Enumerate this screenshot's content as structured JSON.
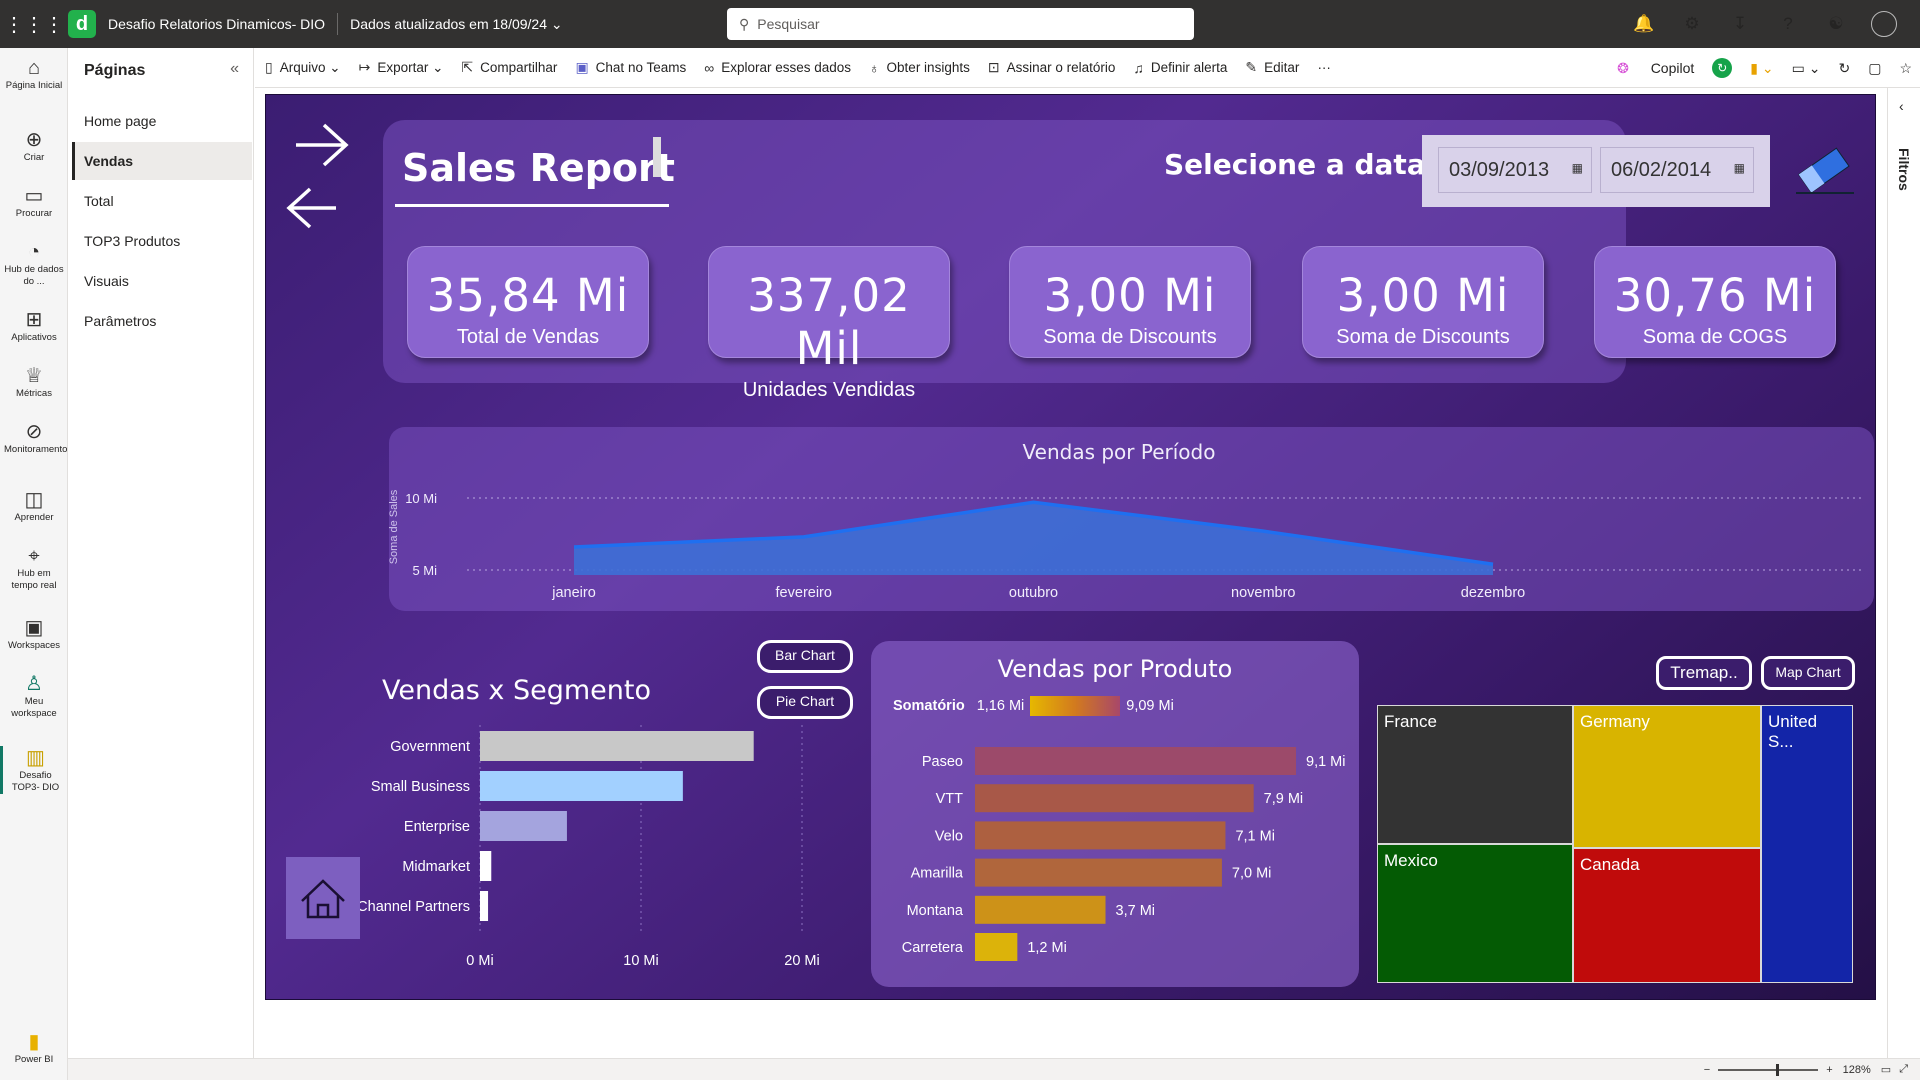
{
  "topbar": {
    "report_name": "Desafio Relatorios Dinamicos- DIO",
    "updated": "Dados atualizados em 18/09/24",
    "search_placeholder": "Pesquisar"
  },
  "leftnav": [
    {
      "label": "Página Inicial",
      "icon": "home-icon"
    },
    {
      "label": "Criar",
      "icon": "plus-icon"
    },
    {
      "label": "Procurar",
      "icon": "folder-icon"
    },
    {
      "label": "Hub de dados do ...",
      "icon": "data-hub-icon"
    },
    {
      "label": "Aplicativos",
      "icon": "apps-icon"
    },
    {
      "label": "Métricas",
      "icon": "trophy-icon"
    },
    {
      "label": "Monitoramento",
      "icon": "monitor-icon"
    },
    {
      "label": "Aprender",
      "icon": "book-icon"
    },
    {
      "label": "Hub em tempo real",
      "icon": "realtime-icon"
    },
    {
      "label": "Workspaces",
      "icon": "workspaces-icon"
    },
    {
      "label": "Meu workspace",
      "icon": "user-icon"
    },
    {
      "label": "Desafio TOP3- DIO",
      "icon": "report-icon"
    },
    {
      "label": "Power BI",
      "icon": "powerbi-icon"
    }
  ],
  "pages": {
    "title": "Páginas",
    "items": [
      "Home page",
      "Vendas",
      "Total",
      "TOP3 Produtos",
      "Visuais",
      "Parâmetros"
    ],
    "active": "Vendas"
  },
  "toolbar": {
    "items": [
      "Arquivo",
      "Exportar",
      "Compartilhar",
      "Chat no Teams",
      "Explorar esses dados",
      "Obter insights",
      "Assinar o relatório",
      "Definir alerta",
      "Editar",
      "···"
    ],
    "copilot": "Copilot"
  },
  "filters": {
    "label": "Filtros"
  },
  "status": {
    "zoom": "128%"
  },
  "report": {
    "title": "Sales Report",
    "date_prompt": "Selecione a data",
    "date_start": "03/09/2013",
    "date_end": "06/02/2014",
    "cards": [
      {
        "value": "35,84 Mi",
        "label": "Total de Vendas"
      },
      {
        "value": "337,02 Mil",
        "label": "Unidades Vendidas"
      },
      {
        "value": "3,00 Mi",
        "label": "Soma de Discounts"
      },
      {
        "value": "3,00 Mi",
        "label": "Soma de Discounts"
      },
      {
        "value": "30,76 Mi",
        "label": "Soma de COGS"
      }
    ],
    "buttons": {
      "bar": "Bar Chart",
      "pie": "Pie Chart",
      "treemap": "Tremap..",
      "map": "Map Chart"
    }
  },
  "colors": {
    "line": "#1f6ff0",
    "area": "#3d6fd6",
    "treemap_france": "#333333",
    "treemap_germany": "#d8b400",
    "treemap_us": "#1325a8",
    "treemap_mexico": "#045b04",
    "treemap_canada": "#c00b0b"
  },
  "chart_data": [
    {
      "type": "area",
      "title": "Vendas por Período",
      "ylabel": "Soma de Sales",
      "categories": [
        "janeiro",
        "fevereiro",
        "outubro",
        "novembro",
        "dezembro"
      ],
      "values": [
        6.6,
        7.3,
        9.7,
        7.7,
        5.4
      ],
      "yticks": [
        "10 Mi",
        "5 Mi"
      ],
      "ylim": [
        0,
        10
      ]
    },
    {
      "type": "bar",
      "title": "Vendas x Segmento",
      "categories": [
        "Government",
        "Small Business",
        "Enterprise",
        "Midmarket",
        "Channel Partners"
      ],
      "values": [
        17.0,
        12.6,
        5.4,
        0.7,
        0.5
      ],
      "colors": [
        "#c8c8c8",
        "#a2d0ff",
        "#a4a4de",
        "#ffffff",
        "#ffffff"
      ],
      "xticks": [
        "0 Mi",
        "10 Mi",
        "20 Mi"
      ],
      "xlim": [
        0,
        20
      ]
    },
    {
      "type": "bar",
      "title": "Vendas por Produto",
      "legend_label": "Somatório",
      "legend_min": "1,16 Mi",
      "legend_max": "9,09 Mi",
      "categories": [
        "Paseo",
        "VTT",
        "Velo",
        "Amarilla",
        "Montana",
        "Carretera"
      ],
      "values": [
        9.1,
        7.9,
        7.1,
        7.0,
        3.7,
        1.2
      ],
      "labels": [
        "9,1 Mi",
        "7,9 Mi",
        "7,1 Mi",
        "7,0 Mi",
        "3,7 Mi",
        "1,2 Mi"
      ],
      "colors": [
        "#9c4a6a",
        "#a85848",
        "#ad6040",
        "#b0663c",
        "#cd9218",
        "#dcb30a"
      ]
    },
    {
      "type": "treemap",
      "categories": [
        "France",
        "Germany",
        "United S...",
        "Mexico",
        "Canada"
      ]
    }
  ]
}
